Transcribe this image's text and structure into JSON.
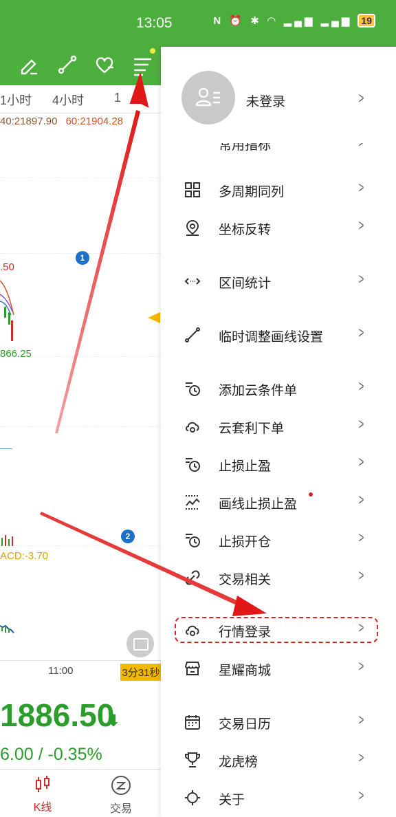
{
  "status_bar": {
    "time": "13:05",
    "icons": [
      "nfc-icon",
      "alarm-icon",
      "bluetooth-icon",
      "data-speed-icon",
      "wifi-icon",
      "4g-signal-icon",
      "5g-signal-icon"
    ],
    "battery": "19"
  },
  "chart": {
    "timeframes": [
      "1小时",
      "4小时",
      "1"
    ],
    "ma_values": [
      "40:21897.90",
      "60:21904.28"
    ],
    "price_high_label": ".50",
    "price_low_label": "866.25",
    "macd_label": "ACD:-3.70",
    "time_tick": "11:00",
    "countdown": "3分31秒",
    "last_price": "1886.50",
    "change": "6.00 / -0.35%",
    "colors": {
      "up": "#d12a2a",
      "down": "#2a9d2a",
      "toolbar": "#4caf3d"
    }
  },
  "bottom_nav": {
    "kline": "K线",
    "trade": "交易"
  },
  "menu": {
    "profile_name": "未登录",
    "cut_item": "常用指标",
    "items": [
      {
        "label": "多周期同列",
        "icon": "grid-icon"
      },
      {
        "label": "坐标反转",
        "icon": "location-pin-icon"
      },
      {
        "label": "区间统计",
        "icon": "range-arrows-icon"
      },
      {
        "label": "临时调整画线设置",
        "icon": "draw-line-icon"
      },
      {
        "label": "添加云条件单",
        "icon": "clock-list-icon"
      },
      {
        "label": "云套利下单",
        "icon": "cloud-arbitrage-icon"
      },
      {
        "label": "止损止盈",
        "icon": "clock-list-icon"
      },
      {
        "label": "画线止损止盈",
        "icon": "chart-stop-icon"
      },
      {
        "label": "止损开仓",
        "icon": "clock-list-icon"
      },
      {
        "label": "交易相关",
        "icon": "link-icon"
      },
      {
        "label": "行情登录",
        "icon": "cloud-login-icon"
      },
      {
        "label": "星耀商城",
        "icon": "store-icon"
      },
      {
        "label": "交易日历",
        "icon": "calendar-icon"
      },
      {
        "label": "龙虎榜",
        "icon": "trophy-icon"
      },
      {
        "label": "关于",
        "icon": "sun-info-icon"
      }
    ]
  },
  "annotations": {
    "badge1": "1",
    "badge2": "2"
  }
}
